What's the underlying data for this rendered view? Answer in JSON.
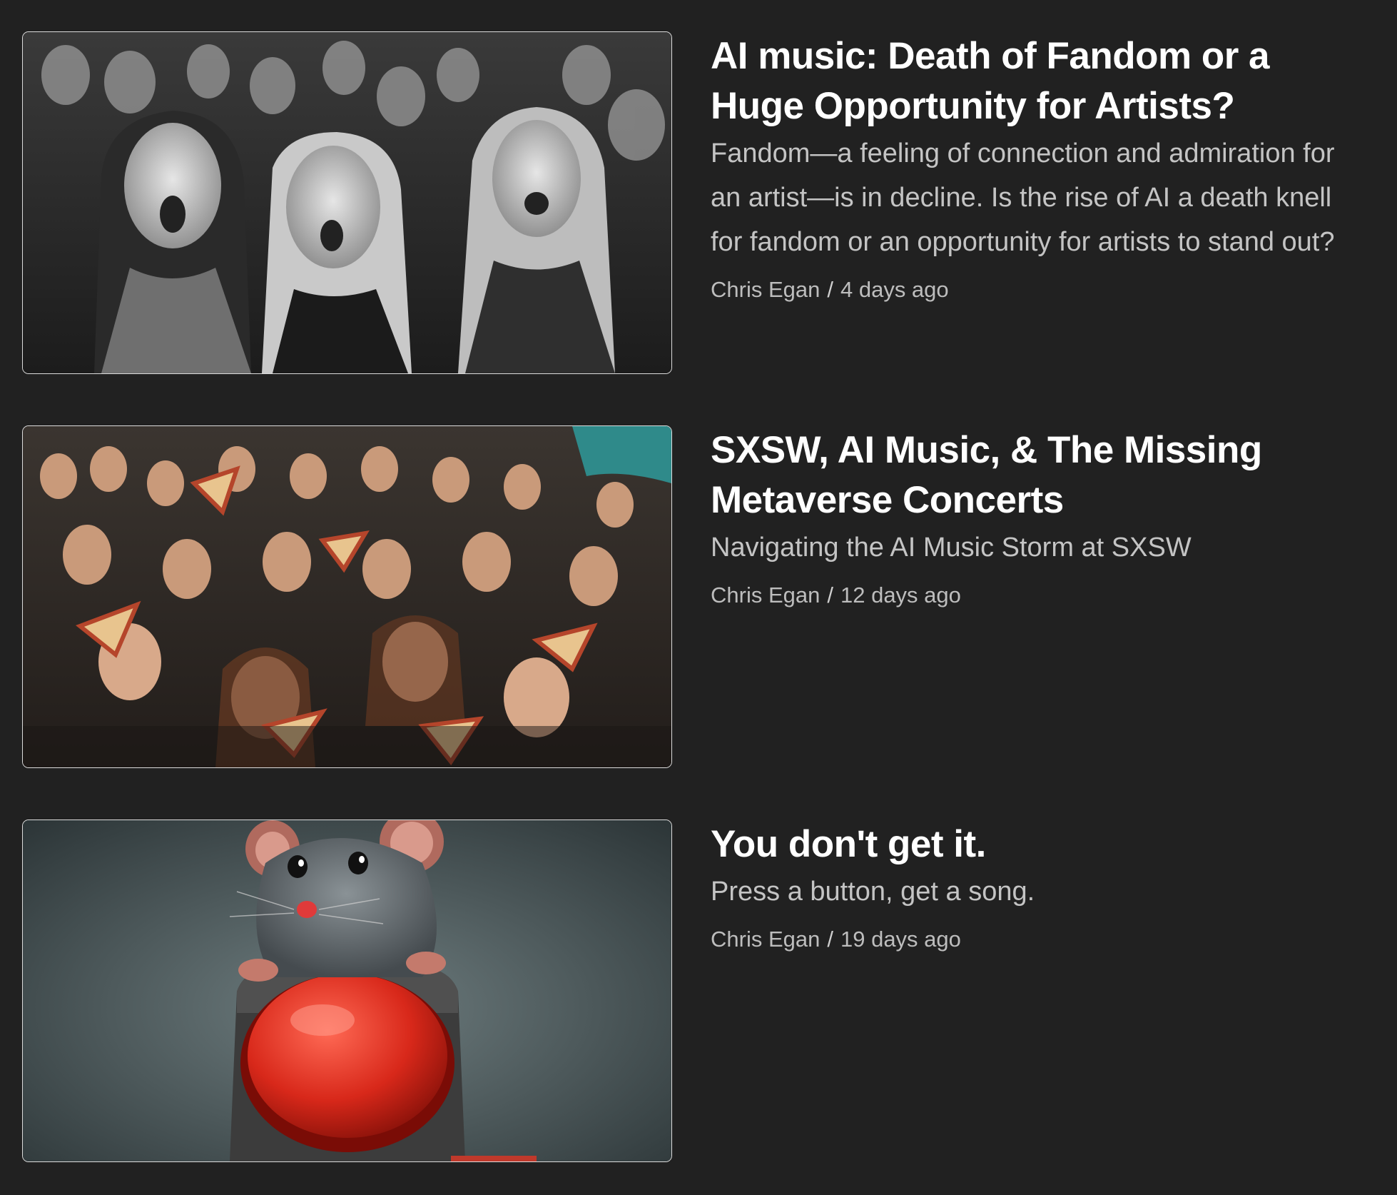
{
  "posts": [
    {
      "title": "AI music: Death of Fandom or a Huge Opportunity for Artists?",
      "excerpt": "Fandom—a feeling of connection and admiration for an artist—is in decline. Is the rise of AI a death knell for fandom or an opportunity for artists to stand out?",
      "author": "Chris Egan",
      "separator": "/",
      "date": "4 days ago"
    },
    {
      "title": "SXSW, AI Music, & The Missing Metaverse Concerts",
      "excerpt": "Navigating the AI Music Storm at SXSW",
      "author": "Chris Egan",
      "separator": "/",
      "date": "12 days ago"
    },
    {
      "title": "You don't get it.",
      "excerpt": "Press a button, get a song.",
      "author": "Chris Egan",
      "separator": "/",
      "date": "19 days ago"
    }
  ],
  "colors": {
    "background": "#212121",
    "title": "#ffffff",
    "excerpt": "#c4c4c4",
    "meta": "#bdbdbd",
    "thumb_border": "#dcdcdc"
  }
}
